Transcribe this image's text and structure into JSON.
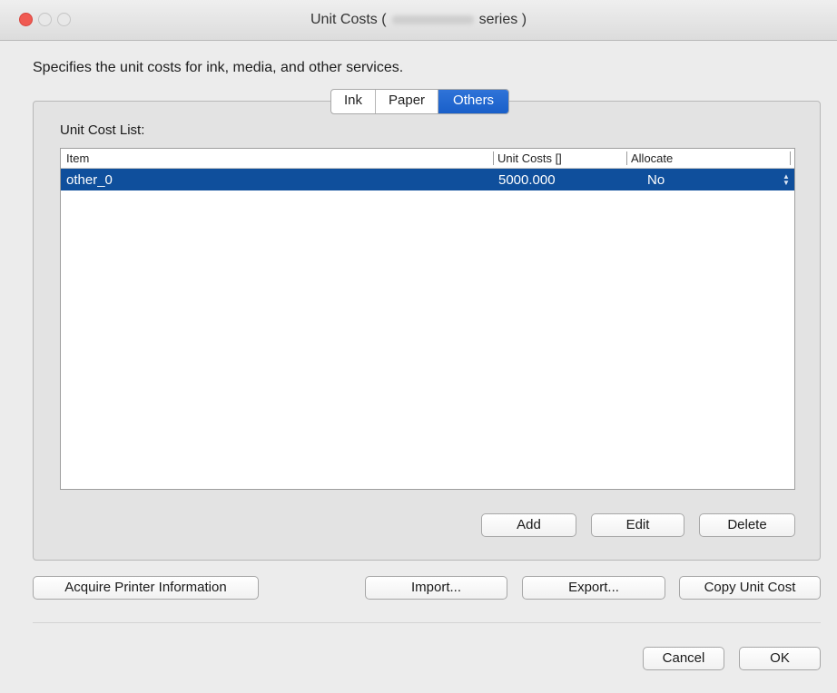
{
  "window": {
    "title_prefix": "Unit Costs (",
    "title_suffix": "series )"
  },
  "description": "Specifies the unit costs for ink, media, and other services.",
  "tabs": [
    {
      "label": "Ink",
      "active": false
    },
    {
      "label": "Paper",
      "active": false
    },
    {
      "label": "Others",
      "active": true
    }
  ],
  "list": {
    "label": "Unit Cost List:",
    "columns": {
      "item": "Item",
      "unit_costs": "Unit Costs []",
      "allocate": "Allocate"
    },
    "rows": [
      {
        "item": "other_0",
        "unit_costs": "5000.000",
        "allocate": "No",
        "selected": true
      }
    ]
  },
  "list_buttons": {
    "add": "Add",
    "edit": "Edit",
    "delete": "Delete"
  },
  "tool_buttons": {
    "acquire": "Acquire Printer Information",
    "import": "Import...",
    "export": "Export...",
    "copy": "Copy Unit Cost"
  },
  "dialog_buttons": {
    "cancel": "Cancel",
    "ok": "OK"
  },
  "colors": {
    "accent": "#195fc9",
    "selection": "#0f4f9c",
    "close": "#f05a52"
  }
}
